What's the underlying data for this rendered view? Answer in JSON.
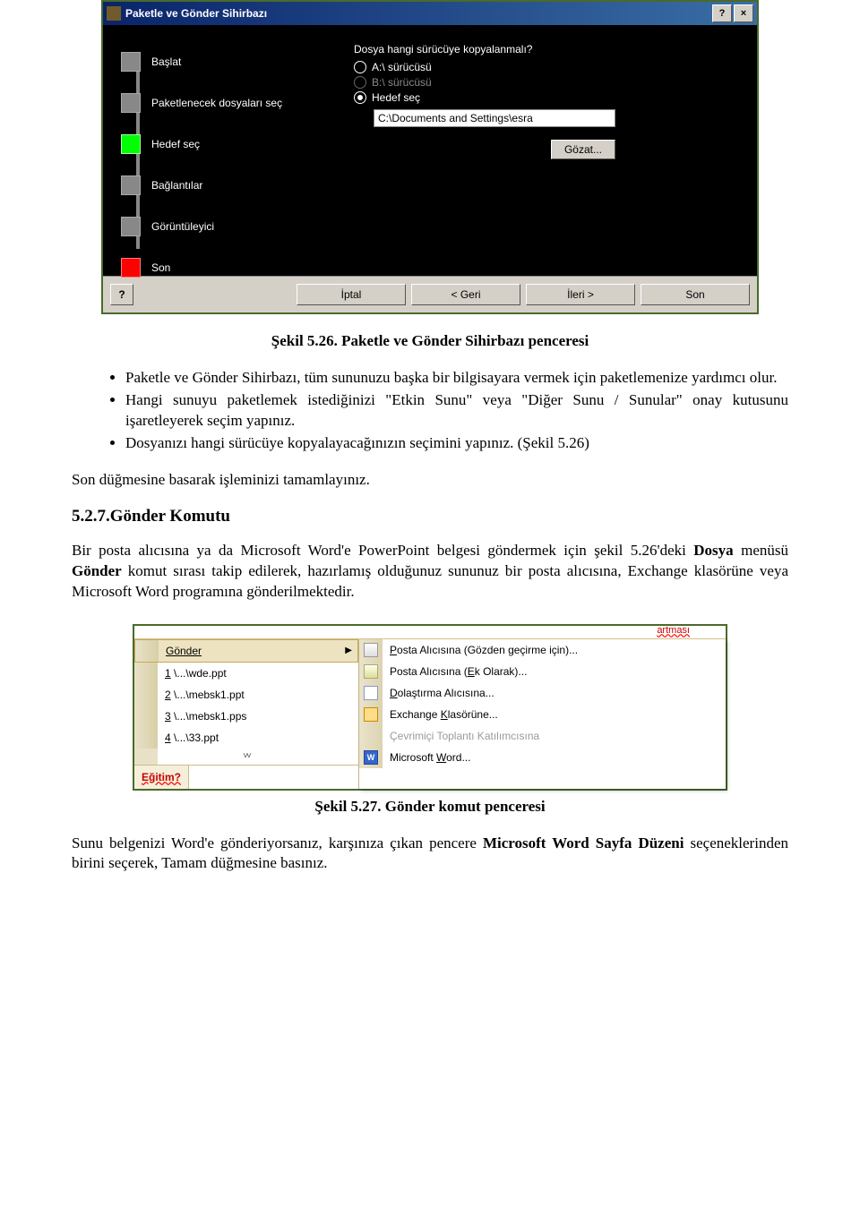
{
  "wizard": {
    "title": "Paketle ve Gönder Sihirbazı",
    "help_btn": "?",
    "close_btn": "×",
    "steps": {
      "s1": "Başlat",
      "s2": "Paketlenecek dosyaları seç",
      "s3": "Hedef seç",
      "s4": "Bağlantılar",
      "s5": "Görüntüleyici",
      "s6": "Son"
    },
    "right": {
      "question": "Dosya hangi sürücüye kopyalanmalı?",
      "opt_a": "A:\\ sürücüsü",
      "opt_b": "B:\\ sürücüsü",
      "opt_c": "Hedef seç",
      "path": "C:\\Documents and Settings\\esra",
      "browse": "Gözat..."
    },
    "footer": {
      "help": "?",
      "cancel": "İptal",
      "back": "< Geri",
      "next": "İleri >",
      "finish": "Son"
    }
  },
  "caption1": "Şekil 5.26. Paketle ve Gönder Sihirbazı penceresi",
  "bullets": {
    "b1": "Paketle ve Gönder Sihirbazı, tüm sununuzu başka bir bilgisayara vermek için paketlemenize yardımcı olur.",
    "b2": "Hangi sunuyu paketlemek istediğinizi \"Etkin Sunu\" veya \"Diğer Sunu / Sunular\" onay kutusunu işaretleyerek seçim yapınız.",
    "b3": "Dosyanızı hangi sürücüye kopyalayacağınızın seçimini yapınız. (Şekil 5.26)"
  },
  "para1": "Son düğmesine basarak işleminizi tamamlayınız.",
  "heading527": "5.2.7.Gönder Komutu",
  "para2_a": "Bir posta alıcısına ya da Microsoft Word'e PowerPoint belgesi göndermek için şekil 5.26'deki ",
  "para2_b": "Dosya",
  "para2_c": " menüsü ",
  "para2_d": "Gönder",
  "para2_e": " komut sırası takip edilerek, hazırlamış olduğunuz sununuz bir posta alıcısına, Exchange klasörüne  veya Microsoft Word programına gönderilmektedir.",
  "menu": {
    "artmasi": "artması",
    "left": {
      "m1": "Gönder",
      "r1a": "1",
      "r1b": " \\...\\wde.ppt",
      "r2a": "2",
      "r2b": " \\...\\mebsk1.ppt",
      "r3a": "3",
      "r3b": " \\...\\mebsk1.pps",
      "r4a": "4",
      "r4b": " \\...\\33.ppt"
    },
    "egitim": "Eğitim?",
    "right": {
      "s1a": "P",
      "s1b": "osta Alıcısına (Gözden geçirme için)...",
      "s2a": "Posta Alıcısına (",
      "s2b": "E",
      "s2c": "k Olarak)...",
      "s3a": "D",
      "s3b": "olaştırma Alıcısına...",
      "s4a": "Exchange ",
      "s4b": "K",
      "s4c": "lasörüne...",
      "s5": "Çevrimiçi Toplantı Katılımcısına",
      "s6a": "Microsoft ",
      "s6b": "W",
      "s6c": "ord..."
    }
  },
  "caption2": "Şekil 5.27. Gönder komut penceresi",
  "para3_a": "Sunu belgenizi Word'e gönderiyorsanız, karşınıza çıkan pencere ",
  "para3_b": "Microsoft Word Sayfa Düzeni",
  "para3_c": " seçeneklerinden birini seçerek, Tamam düğmesine basınız."
}
